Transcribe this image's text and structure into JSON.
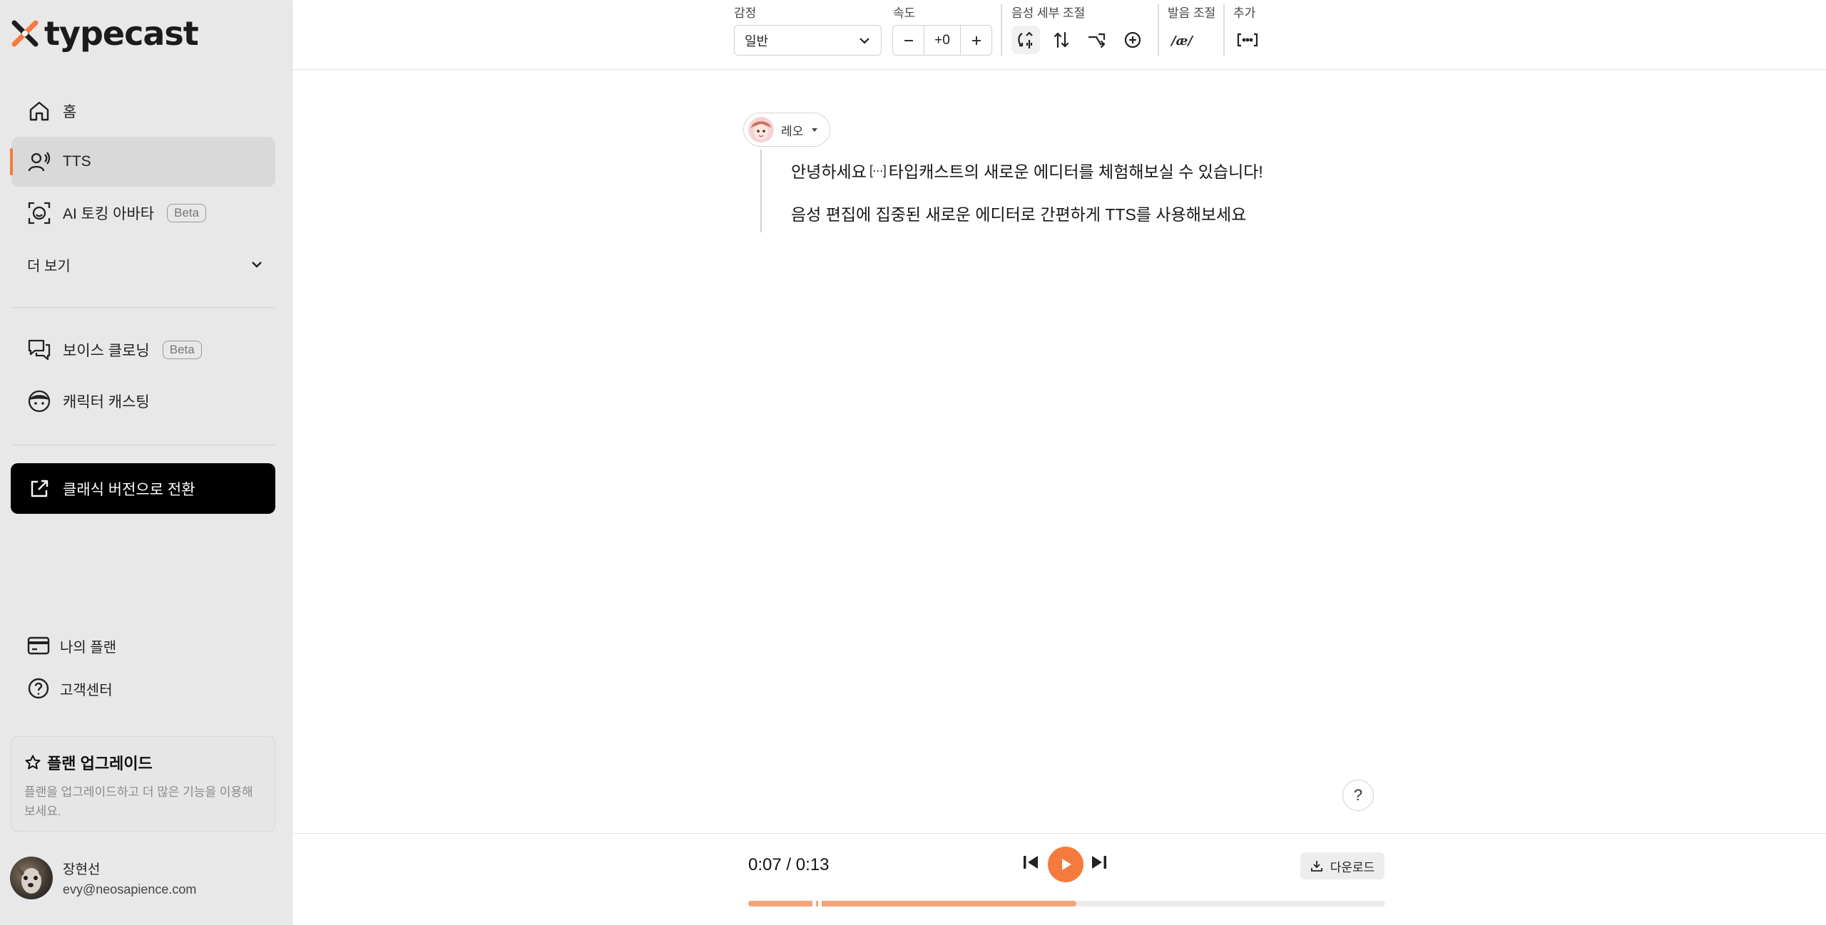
{
  "app": {
    "brand": "typecast"
  },
  "sidebar": {
    "items": [
      {
        "label": "홈"
      },
      {
        "label": "TTS"
      },
      {
        "label": "AI 토킹 아바타",
        "badge": "Beta"
      },
      {
        "label": "보이스 클로닝",
        "badge": "Beta"
      },
      {
        "label": "캐릭터 캐스팅"
      }
    ],
    "more_label": "더 보기",
    "classic_label": "클래식 버전으로 전환",
    "plan_label": "나의 플랜",
    "support_label": "고객센터",
    "upgrade": {
      "title": "플랜 업그레이드",
      "desc_line1": "플랜을 업그레이드하고 더 많은 기능을 이용해",
      "desc_line2": "보세요."
    },
    "user": {
      "name": "장현선",
      "email": "evy@neosapience.com"
    }
  },
  "toolbar": {
    "emotion_label": "감정",
    "emotion_value": "일반",
    "speed_label": "속도",
    "speed_value": "+0",
    "detail_label": "음성 세부 조절",
    "pron_label": "발음 조절",
    "add_label": "추가"
  },
  "editor": {
    "speaker": "레오",
    "line1_before": "안녕하세요",
    "pause_tag": "[···]",
    "line1_after": "타입캐스트의 새로운 에디터를 체험해보실 수 있습니다!",
    "line2": "음성 편집에 집중된 새로운 에디터로 간편하게 TTS를 사용해보세요"
  },
  "player": {
    "time": "0:07 / 0:13",
    "download_label": "다운로드",
    "progress": 0.515
  },
  "help_label": "?",
  "colors": {
    "accent": "#f47a3d",
    "sidebar_bg": "#e8e8e8",
    "classic_btn": "#000000"
  },
  "icons": [
    "home-icon",
    "tts-icon",
    "avatar-face-icon",
    "chevron-down-icon",
    "chat-icon",
    "character-icon",
    "external-link-icon",
    "card-icon",
    "help-circle-icon",
    "star-icon",
    "rewind-icon",
    "play-icon",
    "skip-icon"
  ]
}
